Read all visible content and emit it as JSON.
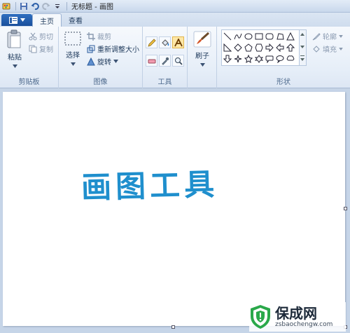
{
  "window": {
    "title": "无标题 - 画图"
  },
  "tabs": [
    {
      "label": "主页"
    },
    {
      "label": "查看"
    }
  ],
  "ribbon": {
    "clipboard": {
      "group_label": "剪贴板",
      "paste": "粘贴",
      "cut": "剪切",
      "copy": "复制"
    },
    "image": {
      "group_label": "图像",
      "select": "选择",
      "crop": "裁剪",
      "resize": "重新调整大小",
      "rotate": "旋转"
    },
    "tools": {
      "group_label": "工具"
    },
    "brushes": {
      "label": "刷子"
    },
    "shapes": {
      "group_label": "形状",
      "outline": "轮廓",
      "fill": "填充"
    }
  },
  "canvas": {
    "text": "画图工具"
  },
  "watermark": {
    "title": "保成网",
    "subtitle": "zsbaochengw.com"
  },
  "colors": {
    "art_text": "#1f8fcd",
    "app_menu": "#1a4f9c",
    "selected_tool": "#fde7a6",
    "ribbon_bg": "#e6eef8",
    "workspace_bg": "#c6d5e8",
    "logo_green": "#2aa84a"
  }
}
